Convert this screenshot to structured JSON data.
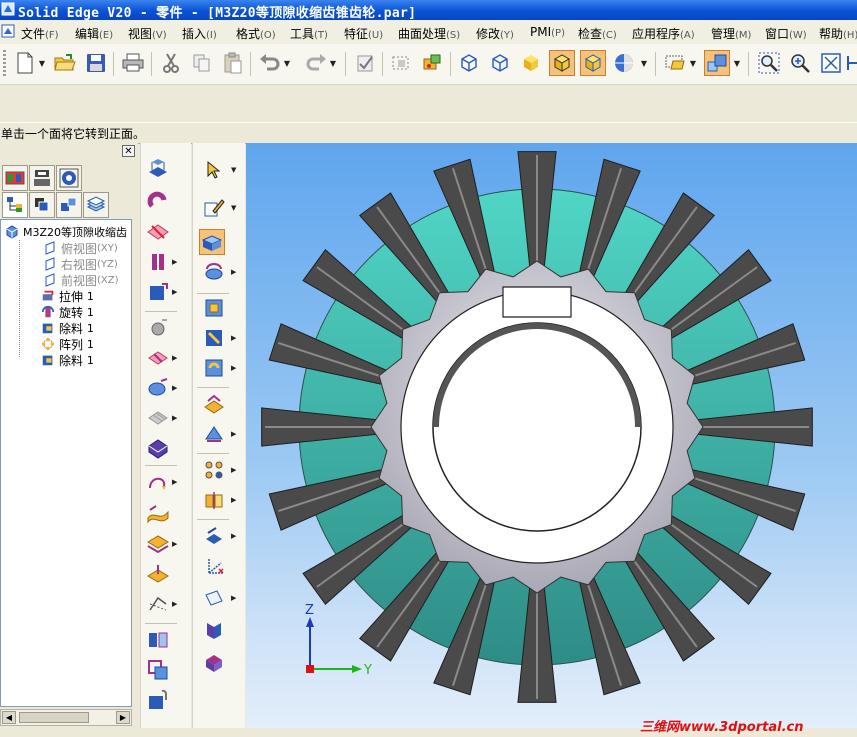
{
  "window": {
    "title": "Solid Edge V20 - 零件 - [M3Z20等顶隙收缩齿锥齿轮.par]"
  },
  "menu": [
    {
      "label": "文件",
      "acc": "(F)"
    },
    {
      "label": "编辑",
      "acc": "(E)"
    },
    {
      "label": "视图",
      "acc": "(V)"
    },
    {
      "label": "插入",
      "acc": "(I)"
    },
    {
      "label": "格式",
      "acc": "(O)"
    },
    {
      "label": "工具",
      "acc": "(T)"
    },
    {
      "label": "特征",
      "acc": "(U)"
    },
    {
      "label": "曲面处理",
      "acc": "(S)"
    },
    {
      "label": "修改",
      "acc": "(Y)"
    },
    {
      "label": "PMI",
      "acc": "(P)"
    },
    {
      "label": "检查",
      "acc": "(C)"
    },
    {
      "label": "应用程序",
      "acc": "(A)"
    },
    {
      "label": "管理",
      "acc": "(M)"
    },
    {
      "label": "窗口",
      "acc": "(W)"
    },
    {
      "label": "帮助",
      "acc": "(H)"
    }
  ],
  "prompt": {
    "text": "单击一个面将它转到正面。"
  },
  "tree": {
    "root": "M3Z20等顶隙收缩齿",
    "items": [
      {
        "label": "俯视图",
        "acc": "(XY)",
        "dim": true,
        "icon": "plane-icon"
      },
      {
        "label": "右视图",
        "acc": "(YZ)",
        "dim": true,
        "icon": "plane-icon"
      },
      {
        "label": "前视图",
        "acc": "(XZ)",
        "dim": true,
        "icon": "plane-icon"
      },
      {
        "label": "拉伸",
        "acc": "1",
        "dim": false,
        "icon": "extrude-icon"
      },
      {
        "label": "旋转",
        "acc": "1",
        "dim": false,
        "icon": "revolve-icon"
      },
      {
        "label": "除料",
        "acc": "1",
        "dim": false,
        "icon": "cutout-icon"
      },
      {
        "label": "阵列",
        "acc": "1",
        "dim": false,
        "icon": "pattern-icon"
      },
      {
        "label": "除料",
        "acc": "1",
        "dim": false,
        "icon": "cutout-icon"
      }
    ]
  },
  "triad": {
    "z": "Z",
    "y": "Y"
  },
  "watermark": {
    "text": "三维网www.3dportal.cn"
  },
  "colors": {
    "teal_light": "#50d6c5",
    "teal_dark": "#2e8c86",
    "tooth_dark": "#4a4a4a",
    "hub": "#d4d3db",
    "accent_active": "#f6c27a"
  }
}
